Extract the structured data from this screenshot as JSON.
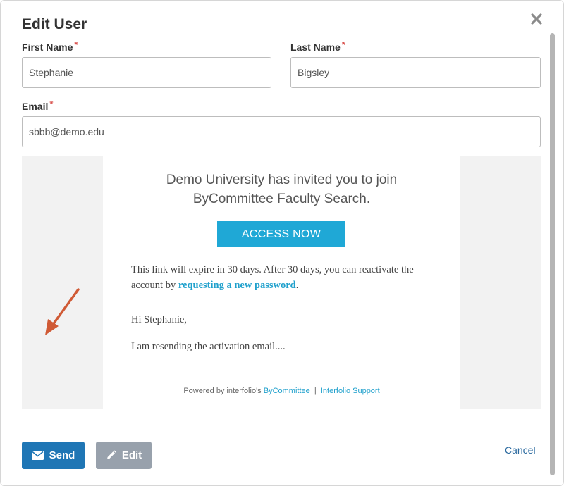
{
  "modal": {
    "title": "Edit User"
  },
  "form": {
    "first_name": {
      "label": "First Name",
      "required_mark": "*",
      "value": "Stephanie"
    },
    "last_name": {
      "label": "Last Name",
      "required_mark": "*",
      "value": "Bigsley"
    },
    "email": {
      "label": "Email",
      "required_mark": "*",
      "value": "sbbb@demo.edu"
    }
  },
  "preview": {
    "invite_line1": "Demo University has invited you to join",
    "invite_line2": "ByCommittee Faculty Search.",
    "access_button": "ACCESS NOW",
    "expire_text_before": "This link will expire in 30 days. After 30 days, you can reactivate the account by ",
    "expire_link": "requesting a new password",
    "expire_text_after": ".",
    "greeting": "Hi Stephanie,",
    "message": "I am resending the activation email....",
    "footer_prefix": "Powered by interfolio's ",
    "footer_link1": "ByCommittee",
    "footer_sep": "|",
    "footer_link2": "Interfolio Support"
  },
  "actions": {
    "send_label": "Send",
    "edit_label": "Edit",
    "cancel_label": "Cancel"
  },
  "icons": {
    "close": "close-icon",
    "send": "envelope-icon",
    "edit": "pencil-icon",
    "annotation": "arrow-icon"
  },
  "colors": {
    "primary_button": "#1f76b5",
    "secondary_button": "#98a1ac",
    "access_button": "#1fa8d6",
    "link": "#1fa0cc",
    "required": "#d9534f",
    "annotation_arrow": "#d05a35"
  }
}
